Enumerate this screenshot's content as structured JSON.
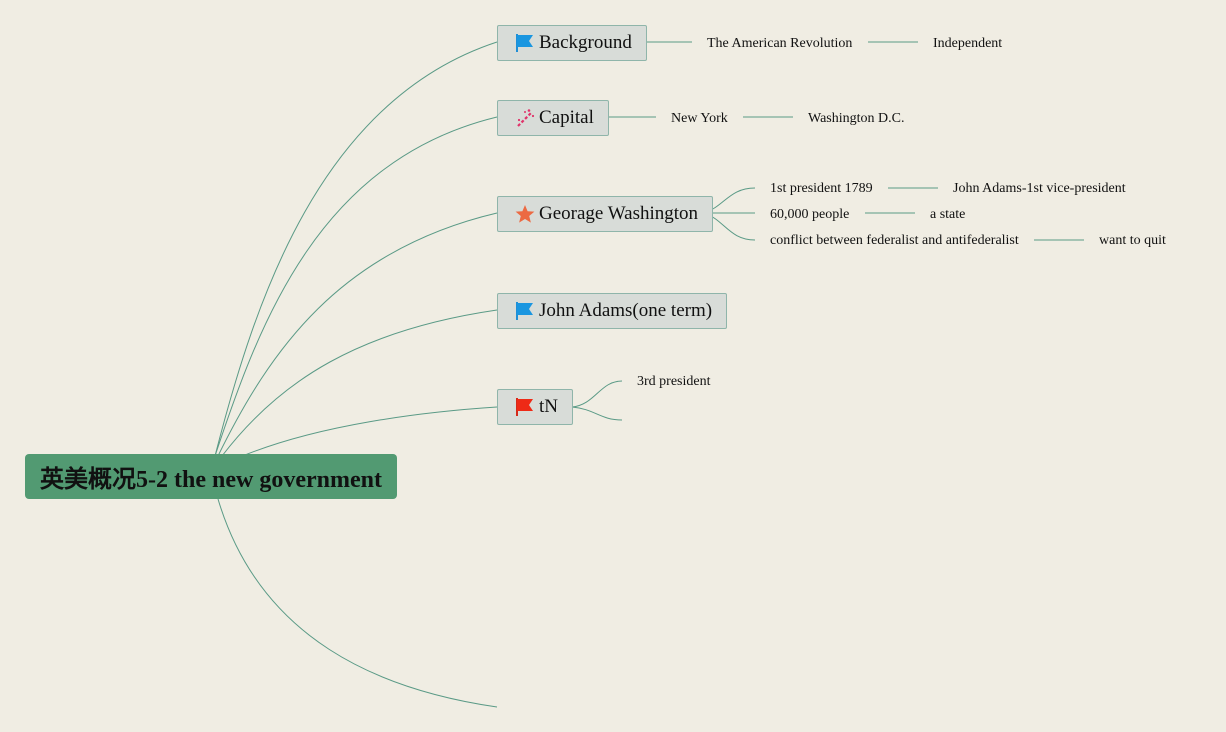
{
  "root": {
    "title": "英美概况5-2 the new government"
  },
  "colors": {
    "root_fill": "#529a72",
    "line": "#5a9a86",
    "node_fill": "#d8dcd8",
    "node_border": "#8fb5aa"
  },
  "branches": [
    {
      "label": "Background",
      "icon": "blue-flag-icon",
      "children": [
        {
          "label": "The American Revolution",
          "children": [
            {
              "label": "Independent"
            }
          ]
        }
      ]
    },
    {
      "label": "Capital",
      "icon": "magic-wand-icon",
      "children": [
        {
          "label": "New York",
          "children": [
            {
              "label": "Washington D.C."
            }
          ]
        }
      ]
    },
    {
      "label": "Georage Washington",
      "icon": "orange-star-icon",
      "children": [
        {
          "label": "1st president 1789",
          "children": [
            {
              "label": "John Adams-1st vice-president"
            }
          ]
        },
        {
          "label": "60,000 people",
          "children": [
            {
              "label": "a state"
            }
          ]
        },
        {
          "label": "conflict between federalist and antifederalist",
          "children": [
            {
              "label": "want to quit"
            }
          ]
        }
      ]
    },
    {
      "label": "John Adams(one term)",
      "icon": "blue-flag-icon",
      "children": []
    },
    {
      "label": "tN",
      "icon": "red-flag-icon",
      "children": [
        {
          "label": "3rd president"
        },
        {
          "label": ""
        }
      ]
    }
  ]
}
